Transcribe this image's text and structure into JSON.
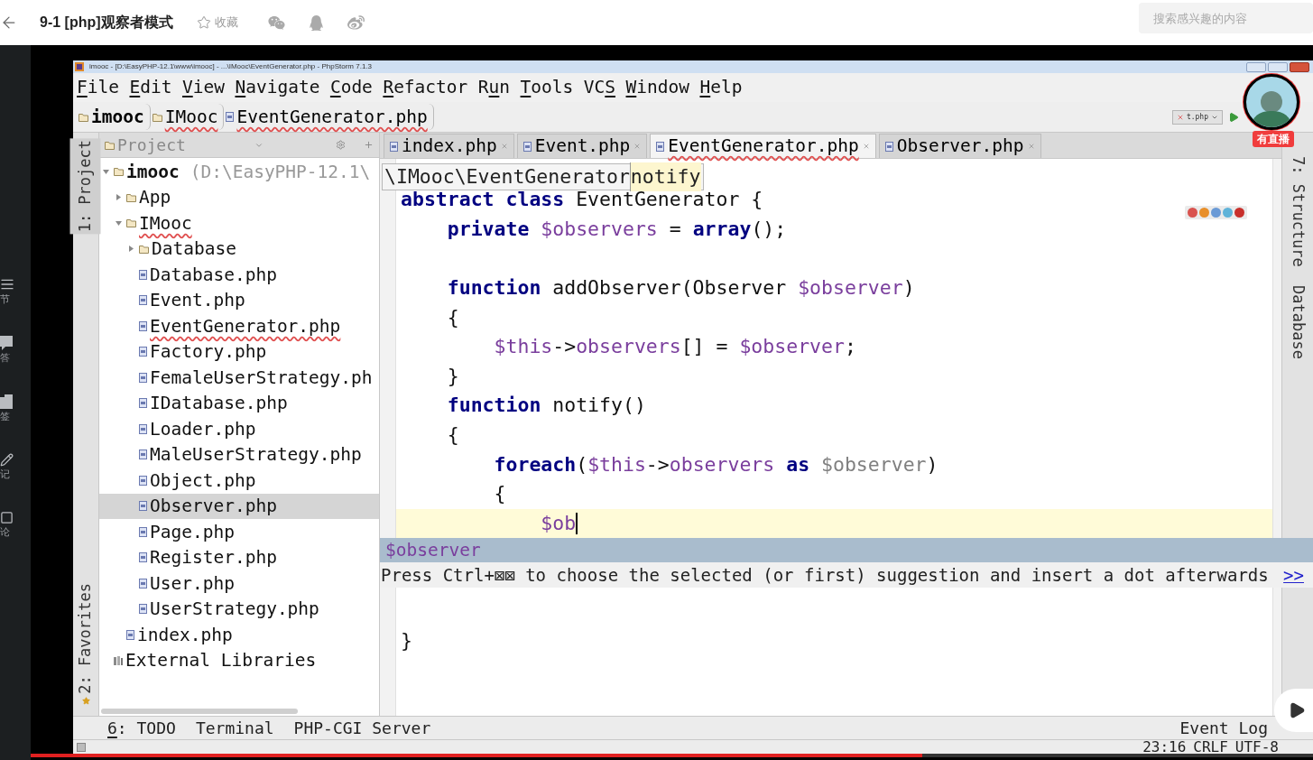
{
  "page_header": {
    "title": "9-1 [php]观察者模式",
    "favorite": {
      "label": "收藏",
      "selected": false
    },
    "search": {
      "placeholder": "搜索感兴趣的内容"
    }
  },
  "side_nav": [
    {
      "kind": "chapters",
      "label": "节"
    },
    {
      "kind": "qa",
      "label": "答"
    },
    {
      "kind": "bookmark",
      "label": "签"
    },
    {
      "kind": "notes",
      "label": "记"
    },
    {
      "kind": "comments",
      "label": "论"
    }
  ],
  "video": {
    "progress": {
      "level": 0.695
    },
    "live_badge": "有直播"
  },
  "ide": {
    "window_title": "imooc - [D:\\EasyPHP-12.1\\www\\imooc] - ...\\IMooc\\EventGenerator.php - PhpStorm 7.1.3",
    "menu": [
      {
        "parts": [
          {
            "text": "F",
            "underlined": true
          },
          {
            "text": "ile",
            "underlined": false
          }
        ]
      },
      {
        "parts": [
          {
            "text": "E",
            "underlined": true
          },
          {
            "text": "dit",
            "underlined": false
          }
        ]
      },
      {
        "parts": [
          {
            "text": "V",
            "underlined": true
          },
          {
            "text": "iew",
            "underlined": false
          }
        ]
      },
      {
        "parts": [
          {
            "text": "N",
            "underlined": true
          },
          {
            "text": "avigate",
            "underlined": false
          }
        ]
      },
      {
        "parts": [
          {
            "text": "C",
            "underlined": true
          },
          {
            "text": "ode",
            "underlined": false
          }
        ]
      },
      {
        "parts": [
          {
            "text": "R",
            "underlined": true
          },
          {
            "text": "efactor",
            "underlined": false
          }
        ]
      },
      {
        "parts": [
          {
            "text": "R",
            "underlined": false
          },
          {
            "text": "u",
            "underlined": true
          },
          {
            "text": "n",
            "underlined": false
          }
        ]
      },
      {
        "parts": [
          {
            "text": "T",
            "underlined": true
          },
          {
            "text": "ools",
            "underlined": false
          }
        ]
      },
      {
        "parts": [
          {
            "text": "VC",
            "underlined": false
          },
          {
            "text": "S",
            "underlined": true
          }
        ]
      },
      {
        "parts": [
          {
            "text": "W",
            "underlined": true
          },
          {
            "text": "indow",
            "underlined": false
          }
        ]
      },
      {
        "parts": [
          {
            "text": "H",
            "underlined": true
          },
          {
            "text": "elp",
            "underlined": false
          }
        ]
      }
    ],
    "breadcrumbs": [
      {
        "kind": "folder",
        "label": "imooc",
        "error": false
      },
      {
        "kind": "folder",
        "label": "IMooc",
        "error": true
      },
      {
        "kind": "file",
        "label": "EventGenerator.php",
        "error": true
      }
    ],
    "run_config": "t.php",
    "left_strip": {
      "top": "1: Project",
      "bottom": "2: Favorites"
    },
    "right_strip": {
      "top": "7: Structure",
      "bottom": "Database"
    },
    "project_panel": {
      "title": "Project",
      "tree": [
        {
          "kind": "folder",
          "label": "imooc",
          "suffix": "(D:\\EasyPHP-12.1\\",
          "expanded": true,
          "selected": false,
          "error": false,
          "children": [
            {
              "kind": "folder",
              "label": "App",
              "expanded": false,
              "selected": false,
              "error": false
            },
            {
              "kind": "folder",
              "label": "IMooc",
              "expanded": true,
              "selected": false,
              "error": true,
              "children": [
                {
                  "kind": "folder",
                  "label": "Database",
                  "expanded": false,
                  "selected": false,
                  "error": false
                },
                {
                  "kind": "file",
                  "label": "Database.php",
                  "selected": false,
                  "error": false
                },
                {
                  "kind": "file",
                  "label": "Event.php",
                  "selected": false,
                  "error": false
                },
                {
                  "kind": "file",
                  "label": "EventGenerator.php",
                  "selected": false,
                  "error": true
                },
                {
                  "kind": "file",
                  "label": "Factory.php",
                  "selected": false,
                  "error": false
                },
                {
                  "kind": "file",
                  "label": "FemaleUserStrategy.ph",
                  "selected": false,
                  "error": false
                },
                {
                  "kind": "file",
                  "label": "IDatabase.php",
                  "selected": false,
                  "error": false
                },
                {
                  "kind": "file",
                  "label": "Loader.php",
                  "selected": false,
                  "error": false
                },
                {
                  "kind": "file",
                  "label": "MaleUserStrategy.php",
                  "selected": false,
                  "error": false
                },
                {
                  "kind": "file",
                  "label": "Object.php",
                  "selected": false,
                  "error": false
                },
                {
                  "kind": "file",
                  "label": "Observer.php",
                  "selected": true,
                  "error": false
                },
                {
                  "kind": "file",
                  "label": "Page.php",
                  "selected": false,
                  "error": false
                },
                {
                  "kind": "file",
                  "label": "Register.php",
                  "selected": false,
                  "error": false
                },
                {
                  "kind": "file",
                  "label": "User.php",
                  "selected": false,
                  "error": false
                },
                {
                  "kind": "file",
                  "label": "UserStrategy.php",
                  "selected": false,
                  "error": false
                }
              ]
            },
            {
              "kind": "file",
              "label": "index.php",
              "selected": false,
              "error": false
            }
          ]
        },
        {
          "kind": "library",
          "label": "External Libraries",
          "selected": false,
          "error": false
        }
      ]
    },
    "tabs": [
      {
        "label": "index.php",
        "selected": false,
        "error": false
      },
      {
        "label": "Event.php",
        "selected": false,
        "error": false
      },
      {
        "label": "EventGenerator.php",
        "selected": true,
        "error": true
      },
      {
        "label": "Observer.php",
        "selected": false,
        "error": false
      }
    ],
    "scope_hint": {
      "path": "\\IMooc\\EventGenerator",
      "member": "notify"
    },
    "code_lines": [
      {
        "current": false,
        "tokens": [
          {
            "kind": "kw",
            "text": "abstract class"
          },
          {
            "kind": "plain",
            "text": " EventGenerator {"
          }
        ]
      },
      {
        "current": false,
        "tokens": [
          {
            "kind": "kw",
            "text": "    private "
          },
          {
            "kind": "var",
            "text": "$observers"
          },
          {
            "kind": "plain",
            "text": " = "
          },
          {
            "kind": "kw",
            "text": "array"
          },
          {
            "kind": "plain",
            "text": "();"
          }
        ]
      },
      {
        "current": false
      },
      {
        "current": false,
        "tokens": [
          {
            "kind": "kw",
            "text": "    function"
          },
          {
            "kind": "plain",
            "text": " addObserver(Observer "
          },
          {
            "kind": "var",
            "text": "$observer"
          },
          {
            "kind": "plain",
            "text": ")"
          }
        ]
      },
      {
        "current": false,
        "tokens": [
          {
            "kind": "plain",
            "text": "    {"
          }
        ]
      },
      {
        "current": false,
        "tokens": [
          {
            "kind": "var",
            "text": "        $this"
          },
          {
            "kind": "plain",
            "text": "->"
          },
          {
            "kind": "var",
            "text": "observers"
          },
          {
            "kind": "plain",
            "text": "[] = "
          },
          {
            "kind": "var",
            "text": "$observer"
          },
          {
            "kind": "plain",
            "text": ";"
          }
        ]
      },
      {
        "current": false,
        "tokens": [
          {
            "kind": "plain",
            "text": "    }"
          }
        ]
      },
      {
        "current": false,
        "tokens": [
          {
            "kind": "kw",
            "text": "    function"
          },
          {
            "kind": "plain",
            "text": " notify()"
          }
        ]
      },
      {
        "current": false,
        "tokens": [
          {
            "kind": "plain",
            "text": "    {"
          }
        ]
      },
      {
        "current": false,
        "tokens": [
          {
            "kind": "kw",
            "text": "        foreach"
          },
          {
            "kind": "plain",
            "text": "("
          },
          {
            "kind": "var",
            "text": "$this"
          },
          {
            "kind": "plain",
            "text": "->"
          },
          {
            "kind": "var",
            "text": "observers"
          },
          {
            "kind": "kw",
            "text": " as "
          },
          {
            "kind": "unused",
            "text": "$observer"
          },
          {
            "kind": "plain",
            "text": ")"
          }
        ]
      },
      {
        "current": false,
        "tokens": [
          {
            "kind": "plain",
            "text": "        {"
          }
        ]
      },
      {
        "current": true,
        "tokens": [
          {
            "kind": "var",
            "text": "            $ob"
          }
        ]
      },
      {
        "current": false
      },
      {
        "current": false,
        "tokens": [
          {
            "kind": "plain",
            "text": "}"
          }
        ]
      }
    ],
    "completion": {
      "item": "$observer",
      "hint": "Press Ctrl+⊠⊠ to choose the selected (or first) suggestion and insert a dot afterwards",
      "more_link": ">>"
    },
    "bottom_tools": [
      {
        "parts": [
          {
            "text": "6",
            "underlined": true
          },
          {
            "text": ": TODO",
            "underlined": false
          }
        ]
      },
      {
        "parts": [
          {
            "text": "Terminal",
            "underlined": false
          }
        ]
      },
      {
        "parts": [
          {
            "text": "PHP-CGI Server",
            "underlined": false
          }
        ]
      }
    ],
    "event_log": "Event Log",
    "status": [
      "23:16",
      "CRLF",
      "UTF-8"
    ]
  }
}
